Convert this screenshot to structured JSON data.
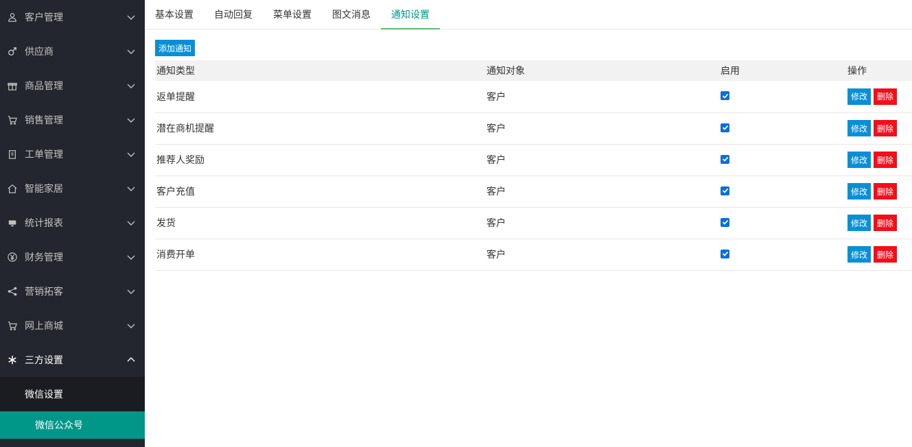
{
  "sidebar": {
    "items": [
      {
        "label": "客户管理",
        "icon": "user-icon"
      },
      {
        "label": "供应商",
        "icon": "male-icon"
      },
      {
        "label": "商品管理",
        "icon": "gift-icon"
      },
      {
        "label": "销售管理",
        "icon": "cart-icon"
      },
      {
        "label": "工单管理",
        "icon": "clipboard-icon"
      },
      {
        "label": "智能家居",
        "icon": "home-icon"
      },
      {
        "label": "统计报表",
        "icon": "monitor-icon"
      },
      {
        "label": "财务管理",
        "icon": "yen-icon"
      },
      {
        "label": "营销拓客",
        "icon": "share-icon"
      },
      {
        "label": "网上商城",
        "icon": "cart-icon"
      },
      {
        "label": "三方设置",
        "icon": "snowflake-icon"
      }
    ],
    "submenu": {
      "label": "微信设置",
      "active_item": "微信公众号"
    }
  },
  "tabs": [
    "基本设置",
    "自动回复",
    "菜单设置",
    "图文消息",
    "通知设置"
  ],
  "active_tab": "通知设置",
  "toolbar": {
    "add_label": "添加通知"
  },
  "table": {
    "headers": [
      "通知类型",
      "通知对象",
      "启用",
      "操作"
    ],
    "rows": [
      {
        "type": "返单提醒",
        "target": "客户",
        "enabled": true
      },
      {
        "type": "潜在商机提醒",
        "target": "客户",
        "enabled": true
      },
      {
        "type": "推荐人奖励",
        "target": "客户",
        "enabled": true
      },
      {
        "type": "客户充值",
        "target": "客户",
        "enabled": true
      },
      {
        "type": "发货",
        "target": "客户",
        "enabled": true
      },
      {
        "type": "消费开单",
        "target": "客户",
        "enabled": true
      }
    ],
    "edit_label": "修改",
    "delete_label": "删除"
  },
  "colors": {
    "sidebar_bg": "#23262e",
    "accent": "#009688",
    "button_blue": "#0a8fd6",
    "button_red": "#f10f1a"
  }
}
